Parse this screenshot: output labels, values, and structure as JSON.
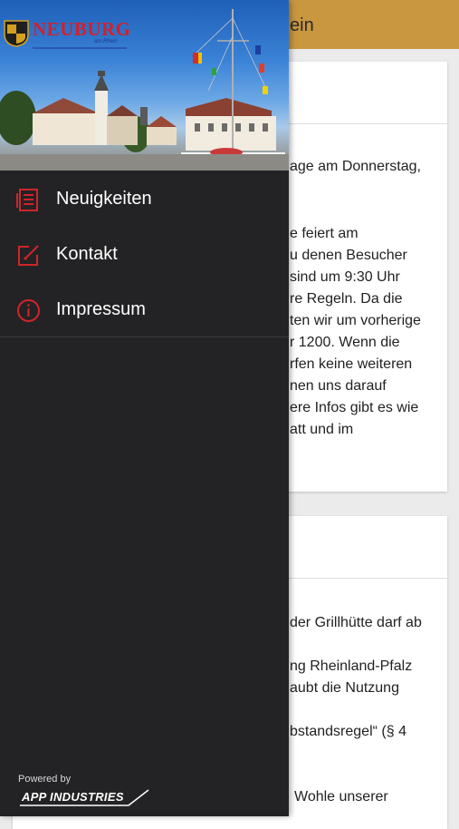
{
  "app": {
    "title_fragment": "ein"
  },
  "card1": {
    "lines": [
      "age am Donnerstag,",
      "e feiert am",
      "u denen Besucher",
      "sind um 9:30 Uhr",
      "re Regeln. Da die",
      "ten wir um vorherige",
      "r 1200. Wenn die",
      "rfen keine weiteren",
      "nen uns darauf",
      "ere Infos gibt es wie",
      "att und im"
    ]
  },
  "card2": {
    "lines": [
      "der Grillhütte darf ab",
      "ng Rheinland-Pfalz",
      "aubt die Nutzung",
      "bstandsregel“ (§ 4",
      "Wohle unserer"
    ]
  },
  "drawer": {
    "logo": {
      "name": "NEUBURG",
      "suffix": "am Rhein"
    },
    "menu": [
      {
        "label": "Neuigkeiten",
        "icon": "newspaper-icon"
      },
      {
        "label": "Kontakt",
        "icon": "edit-icon"
      },
      {
        "label": "Impressum",
        "icon": "info-icon"
      }
    ],
    "footer": {
      "powered_by": "Powered by",
      "brand": "APP INDUSTRIES"
    }
  },
  "colors": {
    "accent": "#c8973f",
    "menu_icon": "#d1242a",
    "drawer_bg": "#232325"
  }
}
